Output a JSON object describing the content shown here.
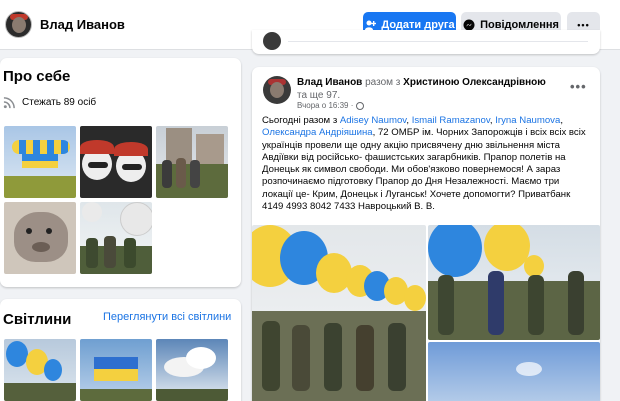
{
  "header": {
    "name": "Влад Иванов",
    "add_friend": "Додати друга",
    "message": "Повідомлення",
    "more": "•••"
  },
  "about": {
    "title": "Про себе",
    "follow": "Стежать 89 осіб"
  },
  "photos": {
    "title": "Світлини",
    "see_all": "Переглянути всі світлини"
  },
  "post": {
    "author": "Влад Иванов",
    "with_word": " разом з ",
    "with_name": "Христиною Олександрівною",
    "and_more": " та ще 97.",
    "time": "Вчора о 16:39 · ",
    "more": "•••",
    "text_intro": "Сьогодні разом з ",
    "tags": [
      "Adisey  Naumov",
      "Ismail Ramazanov",
      "Iryna Naumova",
      "Олександра Андріяшина"
    ],
    "tag_sep": ", ",
    "text_body": ", 72 ОМБР ім. Чорних Запорожців і всіх всіх всіх українців провели ще одну акцію присвячену дню звільнення міста Авдіївки від російсько- фашистських загарбників. Прапор полетів на Донецьк як символ свободи. Ми обов'язково повернемося! А зараз розпочинаємо підготовку Прапор до Дня Незалежності. Маємо три локації це- Крим, Донецьк і Луганськ! Хочете допомогти? Приватбанк 4149 4993 8042 7433 Навроцький В. В."
  },
  "colors": {
    "accent": "#1877f2",
    "link": "#1b74e4",
    "balloon_yellow": "#f4d03f",
    "balloon_blue": "#2e86de"
  }
}
